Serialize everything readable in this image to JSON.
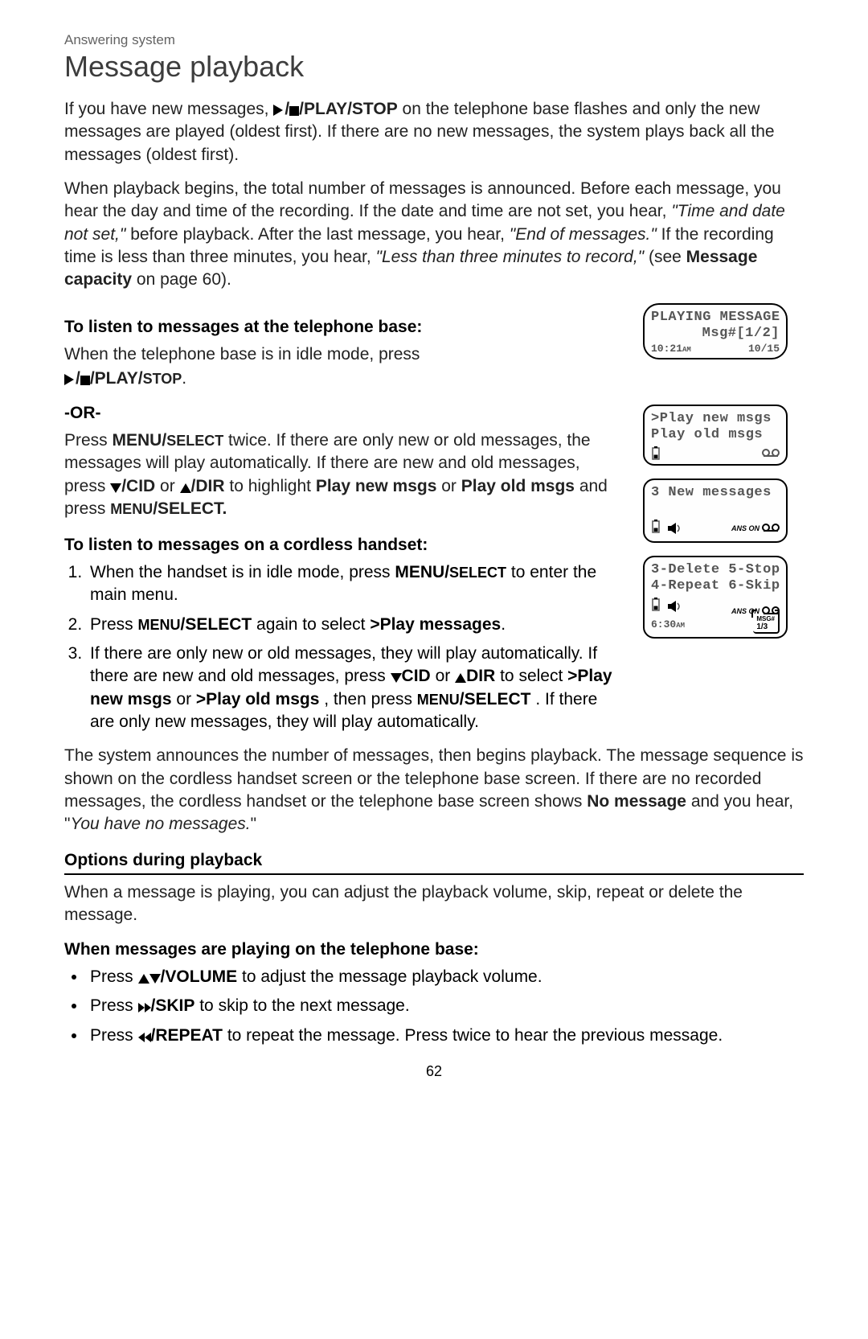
{
  "header": {
    "breadcrumb": "Answering system",
    "title": "Message playback"
  },
  "intro": {
    "p1_pre": "If you have new messages, ",
    "p1_key": "/PLAY/STOP",
    "p1_post": " on the telephone base flashes and only the new messages are played (oldest first). If there are no new messages, the system plays back all the messages (oldest first).",
    "p2_a": "When playback begins, the total number of messages is announced. Before each message, you hear the day and time of the recording. If the date and time are not set, you hear, ",
    "p2_q1": "\"Time and date not set,\"",
    "p2_b": " before playback. After the last message, you hear, ",
    "p2_q2": "\"End of messages.\"",
    "p2_c": " If the recording time is less than three minutes, you hear, ",
    "p2_q3": "\"Less than three minutes to record,\"",
    "p2_d": " (see ",
    "p2_ref": "Message capacity",
    "p2_e": " on page 60)."
  },
  "base": {
    "head": "To listen to messages at the telephone base:",
    "line1": "When the telephone base is in idle mode, press",
    "key": "/PLAY/",
    "key_small": "STOP",
    "period": ".",
    "or": "-OR-",
    "p2_a": "Press ",
    "p2_menu": "MENU/",
    "p2_select": "SELECT",
    "p2_b": " twice. If there are only new or old messages, the messages will play automatically. If there are new and old messages, press ",
    "p2_cid": "/CID",
    "p2_or": " or ",
    "p2_dir": "/DIR",
    "p2_c": " to highlight ",
    "p2_opt1": "Play new msgs",
    "p2_or2": " or ",
    "p2_opt2": "Play old msgs",
    "p2_d": " and press ",
    "p2_menu2": "MENU",
    "p2_select2": "/SELECT.",
    "handset_head": "To listen to messages on a cordless handset:",
    "li1_a": "When the handset is in idle mode, press ",
    "li1_menu": "MENU/",
    "li1_select": "SELECT",
    "li1_b": " to enter the main menu.",
    "li2_a": "Press ",
    "li2_menu": "MENU",
    "li2_select": "/SELECT",
    "li2_b": " again to select ",
    "li2_opt": ">Play messages",
    "li2_c": ".",
    "li3_a": "If there are only new or old messages, they will play automatically. If there are new and old messages, press ",
    "li3_cid": "CID",
    "li3_b": " or ",
    "li3_dir": "DIR",
    "li3_c": " to select ",
    "li3_opt1": ">Play new msgs",
    "li3_or": " or ",
    "li3_opt2": ">Play old msgs",
    "li3_d": ", then press ",
    "li3_menu": "MENU",
    "li3_select": "/SELECT",
    "li3_e": ". If there are only new messages, they will play automatically."
  },
  "after": {
    "p_a": "The system announces the number of messages, then begins playback. The message sequence is shown on the cordless handset screen or the telephone base screen. If there are no recorded messages, the cordless handset or the telephone base screen shows ",
    "p_bold": "No message",
    "p_b": " and you hear, \"",
    "p_italic": "You have no messages.",
    "p_c": "\""
  },
  "options": {
    "head": "Options during playback",
    "p1": "When a message is playing, you can adjust the playback volume, skip, repeat or delete the message.",
    "sub": "When messages are playing on the telephone base:",
    "b1_a": "Press ",
    "b1_key": "/VOLUME",
    "b1_b": " to adjust the message playback volume.",
    "b2_a": "Press ",
    "b2_key": "/SKIP",
    "b2_b": " to skip to the next message.",
    "b3_a": "Press ",
    "b3_key": "/REPEAT",
    "b3_b": " to repeat the message. Press twice to hear the previous message."
  },
  "lcd": {
    "s1_l1": "PLAYING MESSAGE",
    "s1_l2": "Msg#[1/2]",
    "s1_time": "10:21",
    "s1_ampm": "AM",
    "s1_date": "10/15",
    "s2_l1": ">Play new msgs",
    "s2_l2": " Play old msgs",
    "s3_l1": "3 New messages",
    "s3_anson": "ANS ON",
    "s4_l1": "3-Delete 5-Stop",
    "s4_l2": "4-Repeat 6-Skip",
    "s4_time": "6:30",
    "s4_ampm": "AM",
    "s4_anson": "ANS ON",
    "s4_msg_label": "MSG#",
    "s4_msg_count": "1/3"
  },
  "page": "62"
}
